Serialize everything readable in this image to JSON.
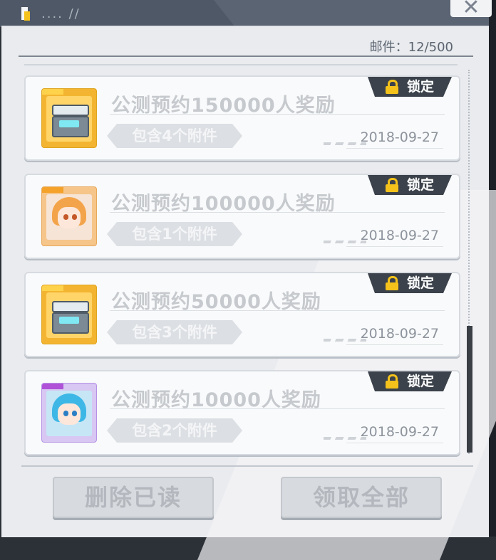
{
  "header": {
    "dots_text": ".... //",
    "close_label": "✕"
  },
  "mail_count": "邮件：12/500",
  "mails": [
    {
      "title": "公测预约150000人奖励",
      "attachments": "包含4个附件",
      "date": "2018-09-27",
      "lock_label": "锁定",
      "icon": "supply-crate-icon",
      "icon_tab_color": "#ffd24c"
    },
    {
      "title": "公测预约100000人奖励",
      "attachments": "包含1个附件",
      "date": "2018-09-27",
      "lock_label": "锁定",
      "icon": "orange-hair-character-icon",
      "icon_tab_color": "#f4a22a"
    },
    {
      "title": "公测预约50000人奖励",
      "attachments": "包含3个附件",
      "date": "2018-09-27",
      "lock_label": "锁定",
      "icon": "supply-crate-icon",
      "icon_tab_color": "#ffd24c"
    },
    {
      "title": "公测预约10000人奖励",
      "attachments": "包含2个附件",
      "date": "2018-09-27",
      "lock_label": "锁定",
      "icon": "blue-hair-character-icon",
      "icon_tab_color": "#b052d8"
    }
  ],
  "footer": {
    "delete_read_label": "删除已读",
    "claim_all_label": "领取全部"
  },
  "colors": {
    "lock_badge_bg": "#3b424b",
    "lock_icon": "#f4c21a",
    "panel_bg": "#e9ebee",
    "title_text": "#c6c9cd"
  }
}
